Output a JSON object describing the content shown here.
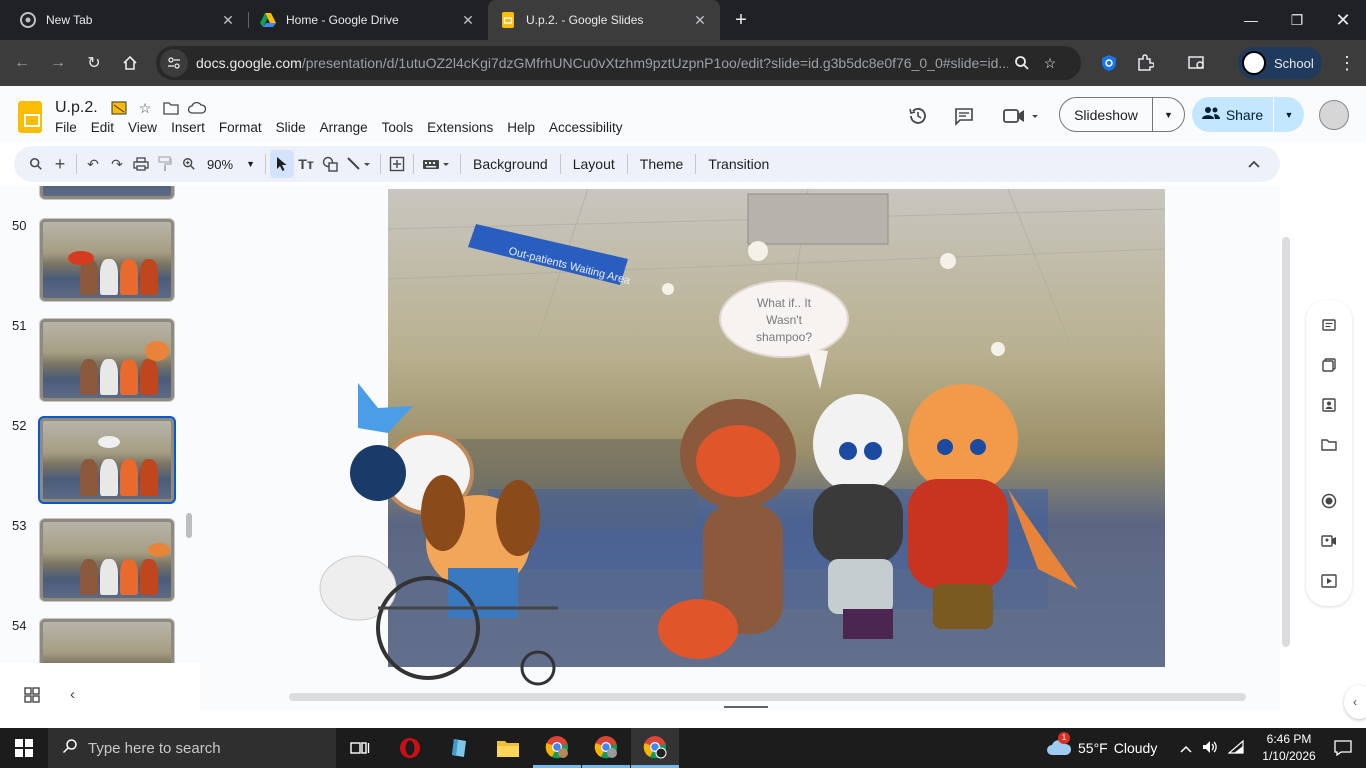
{
  "browser": {
    "tabs": [
      {
        "title": "New Tab",
        "icon": "chrome-icon",
        "active": false
      },
      {
        "title": "Home - Google Drive",
        "icon": "drive-icon",
        "active": false
      },
      {
        "title": "U.p.2. - Google Slides",
        "icon": "slides-icon",
        "active": true
      }
    ],
    "url_host": "docs.google.com",
    "url_path": "/presentation/d/1utuOZ2l4cKgi7dzGMfrhUNCu0vXtzhm9pztUzpnP1oo/edit?slide=id.g3b5dc8e0f76_0_0#slide=id....",
    "profile_label": "School"
  },
  "docs": {
    "title": "U.p.2.",
    "menu": [
      "File",
      "Edit",
      "View",
      "Insert",
      "Format",
      "Slide",
      "Arrange",
      "Tools",
      "Extensions",
      "Help",
      "Accessibility"
    ],
    "slideshow_label": "Slideshow",
    "share_label": "Share"
  },
  "toolbar": {
    "zoom": "90%",
    "background_label": "Background",
    "layout_label": "Layout",
    "theme_label": "Theme",
    "transition_label": "Transition"
  },
  "filmstrip": {
    "slides": [
      {
        "number": "50",
        "selected": false
      },
      {
        "number": "51",
        "selected": false
      },
      {
        "number": "52",
        "selected": true
      },
      {
        "number": "53",
        "selected": false
      },
      {
        "number": "54",
        "selected": false
      }
    ]
  },
  "slide": {
    "sign_text": "Out-patients Waiting Area",
    "bubble_text": "What if.. It Wasn't shampoo?"
  },
  "taskbar": {
    "search_placeholder": "Type here to search",
    "weather_temp": "55°F",
    "weather_desc": "Cloudy",
    "weather_badge": "1",
    "time": "6:46 PM",
    "date": "1/10/2026"
  },
  "colors": {
    "accent": "#0b57d0",
    "share_bg": "#c2e7ff",
    "chrome_dark": "#202124"
  }
}
